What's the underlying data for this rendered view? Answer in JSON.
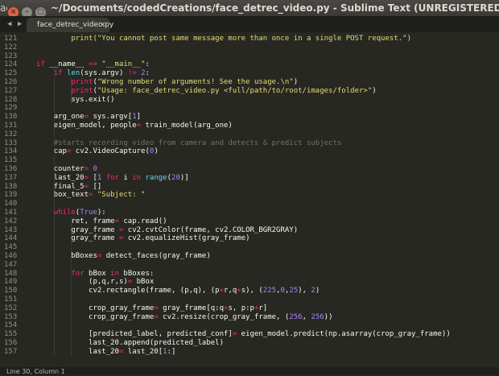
{
  "window": {
    "left_fragment": "ag",
    "title": "~/Documents/codedCreations/face_detrec_video.py - Sublime Text (UNREGISTERED)",
    "buttons": {
      "close": "×",
      "minimize": "–",
      "maximize": "□"
    }
  },
  "tabs": {
    "prev_arrow": "◀",
    "next_arrow": "▶",
    "items": [
      {
        "label": "face_detrec_video.py",
        "close": "×"
      }
    ]
  },
  "editor": {
    "colors": {
      "background": "#272822",
      "keyword": "#f92672",
      "builtin": "#66d9ef",
      "string": "#e6db74",
      "number": "#ae81ff",
      "comment": "#75715e"
    },
    "lines": [
      {
        "num": "121",
        "tokens": [
          {
            "t": "        print(\"You cannot post same message more than once in a single POST request.\")",
            "c": "s"
          }
        ]
      },
      {
        "num": "122",
        "tokens": []
      },
      {
        "num": "123",
        "tokens": []
      },
      {
        "num": "124",
        "tokens": [
          {
            "t": "if",
            "c": "k"
          },
          {
            "t": " __name__ "
          },
          {
            "t": "==",
            "c": "k"
          },
          {
            "t": " "
          },
          {
            "t": "\"__main__\"",
            "c": "s"
          },
          {
            "t": ":"
          }
        ]
      },
      {
        "num": "125",
        "tokens": [
          {
            "t": "    "
          },
          {
            "t": "if",
            "c": "k"
          },
          {
            "t": " "
          },
          {
            "t": "len",
            "c": "bi"
          },
          {
            "t": "(sys.argv) "
          },
          {
            "t": "!=",
            "c": "k"
          },
          {
            "t": " "
          },
          {
            "t": "2",
            "c": "n"
          },
          {
            "t": ":"
          }
        ]
      },
      {
        "num": "126",
        "tokens": [
          {
            "t": "        "
          },
          {
            "t": "print",
            "c": "k"
          },
          {
            "t": "("
          },
          {
            "t": "\"Wrong number of arguments! See the usage.\\n\"",
            "c": "s"
          },
          {
            "t": ")"
          }
        ]
      },
      {
        "num": "127",
        "tokens": [
          {
            "t": "        "
          },
          {
            "t": "print",
            "c": "k"
          },
          {
            "t": "("
          },
          {
            "t": "\"Usage: face_detrec_video.py <full/path/to/root/images/folder>\"",
            "c": "s"
          },
          {
            "t": ")"
          }
        ]
      },
      {
        "num": "128",
        "tokens": [
          {
            "t": "        sys.exit()"
          }
        ]
      },
      {
        "num": "129",
        "tokens": []
      },
      {
        "num": "130",
        "tokens": [
          {
            "t": "    arg_one"
          },
          {
            "t": "=",
            "c": "k"
          },
          {
            "t": " sys.argv["
          },
          {
            "t": "1",
            "c": "n"
          },
          {
            "t": "]"
          }
        ]
      },
      {
        "num": "131",
        "tokens": [
          {
            "t": "    eigen_model, people"
          },
          {
            "t": "=",
            "c": "k"
          },
          {
            "t": " train_model(arg_one)"
          }
        ]
      },
      {
        "num": "132",
        "tokens": []
      },
      {
        "num": "133",
        "tokens": [
          {
            "t": "    "
          },
          {
            "t": "#starts recording video from camera and detects & predict subjects",
            "c": "c"
          }
        ]
      },
      {
        "num": "134",
        "tokens": [
          {
            "t": "    cap"
          },
          {
            "t": "=",
            "c": "k"
          },
          {
            "t": " cv2.VideoCapture("
          },
          {
            "t": "0",
            "c": "n"
          },
          {
            "t": ")"
          }
        ]
      },
      {
        "num": "135",
        "tokens": []
      },
      {
        "num": "136",
        "tokens": [
          {
            "t": "    counter"
          },
          {
            "t": "=",
            "c": "k"
          },
          {
            "t": " "
          },
          {
            "t": "0",
            "c": "n"
          }
        ]
      },
      {
        "num": "137",
        "tokens": [
          {
            "t": "    last_20"
          },
          {
            "t": "=",
            "c": "k"
          },
          {
            "t": " ["
          },
          {
            "t": "1",
            "c": "n"
          },
          {
            "t": " "
          },
          {
            "t": "for",
            "c": "k"
          },
          {
            "t": " i "
          },
          {
            "t": "in",
            "c": "k"
          },
          {
            "t": " "
          },
          {
            "t": "range",
            "c": "bi"
          },
          {
            "t": "("
          },
          {
            "t": "20",
            "c": "n"
          },
          {
            "t": ")]"
          }
        ]
      },
      {
        "num": "138",
        "tokens": [
          {
            "t": "    final_5"
          },
          {
            "t": "=",
            "c": "k"
          },
          {
            "t": " []"
          }
        ]
      },
      {
        "num": "139",
        "tokens": [
          {
            "t": "    box_text"
          },
          {
            "t": "=",
            "c": "k"
          },
          {
            "t": " "
          },
          {
            "t": "\"Subject: \"",
            "c": "s"
          }
        ]
      },
      {
        "num": "140",
        "tokens": []
      },
      {
        "num": "141",
        "tokens": [
          {
            "t": "    "
          },
          {
            "t": "while",
            "c": "k"
          },
          {
            "t": "("
          },
          {
            "t": "True",
            "c": "n"
          },
          {
            "t": "):"
          }
        ]
      },
      {
        "num": "142",
        "tokens": [
          {
            "t": "        ret, frame"
          },
          {
            "t": "=",
            "c": "k"
          },
          {
            "t": " cap.read()"
          }
        ]
      },
      {
        "num": "143",
        "tokens": [
          {
            "t": "        gray_frame "
          },
          {
            "t": "=",
            "c": "k"
          },
          {
            "t": " cv2.cvtColor(frame, cv2.COLOR_BGR2GRAY)"
          }
        ]
      },
      {
        "num": "144",
        "tokens": [
          {
            "t": "        gray_frame "
          },
          {
            "t": "=",
            "c": "k"
          },
          {
            "t": " cv2.equalizeHist(gray_frame)"
          }
        ]
      },
      {
        "num": "145",
        "tokens": []
      },
      {
        "num": "146",
        "tokens": [
          {
            "t": "        bBoxes"
          },
          {
            "t": "=",
            "c": "k"
          },
          {
            "t": " detect_faces(gray_frame)"
          }
        ]
      },
      {
        "num": "147",
        "tokens": []
      },
      {
        "num": "148",
        "tokens": [
          {
            "t": "        "
          },
          {
            "t": "for",
            "c": "k"
          },
          {
            "t": " bBox "
          },
          {
            "t": "in",
            "c": "k"
          },
          {
            "t": " bBoxes:"
          }
        ]
      },
      {
        "num": "149",
        "tokens": [
          {
            "t": "            (p,q,r,s)"
          },
          {
            "t": "=",
            "c": "k"
          },
          {
            "t": " bBox"
          }
        ]
      },
      {
        "num": "150",
        "tokens": [
          {
            "t": "            cv2.rectangle(frame, (p,q), (p"
          },
          {
            "t": "+",
            "c": "k"
          },
          {
            "t": "r,q"
          },
          {
            "t": "+",
            "c": "k"
          },
          {
            "t": "s), ("
          },
          {
            "t": "225",
            "c": "n"
          },
          {
            "t": ","
          },
          {
            "t": "0",
            "c": "n"
          },
          {
            "t": ","
          },
          {
            "t": "25",
            "c": "n"
          },
          {
            "t": "), "
          },
          {
            "t": "2",
            "c": "n"
          },
          {
            "t": ")"
          }
        ]
      },
      {
        "num": "151",
        "tokens": []
      },
      {
        "num": "152",
        "tokens": [
          {
            "t": "            crop_gray_frame"
          },
          {
            "t": "=",
            "c": "k"
          },
          {
            "t": " gray_frame[q:q"
          },
          {
            "t": "+",
            "c": "k"
          },
          {
            "t": "s, p:p"
          },
          {
            "t": "+",
            "c": "k"
          },
          {
            "t": "r]"
          }
        ]
      },
      {
        "num": "153",
        "tokens": [
          {
            "t": "            crop_gray_frame"
          },
          {
            "t": "=",
            "c": "k"
          },
          {
            "t": " cv2.resize(crop_gray_frame, ("
          },
          {
            "t": "256",
            "c": "n"
          },
          {
            "t": ", "
          },
          {
            "t": "256",
            "c": "n"
          },
          {
            "t": "))"
          }
        ]
      },
      {
        "num": "154",
        "tokens": []
      },
      {
        "num": "155",
        "tokens": [
          {
            "t": "            [predicted_label, predicted_conf]"
          },
          {
            "t": "=",
            "c": "k"
          },
          {
            "t": " eigen_model.predict(np.asarray(crop_gray_frame))"
          }
        ]
      },
      {
        "num": "156",
        "tokens": [
          {
            "t": "            last_20.append(predicted_label)"
          }
        ]
      },
      {
        "num": "157",
        "tokens": [
          {
            "t": "            last_20"
          },
          {
            "t": "=",
            "c": "k"
          },
          {
            "t": " last_20["
          },
          {
            "t": "1",
            "c": "n"
          },
          {
            "t": ":]"
          }
        ]
      }
    ]
  },
  "status": {
    "text": "Line 30, Column 1"
  }
}
